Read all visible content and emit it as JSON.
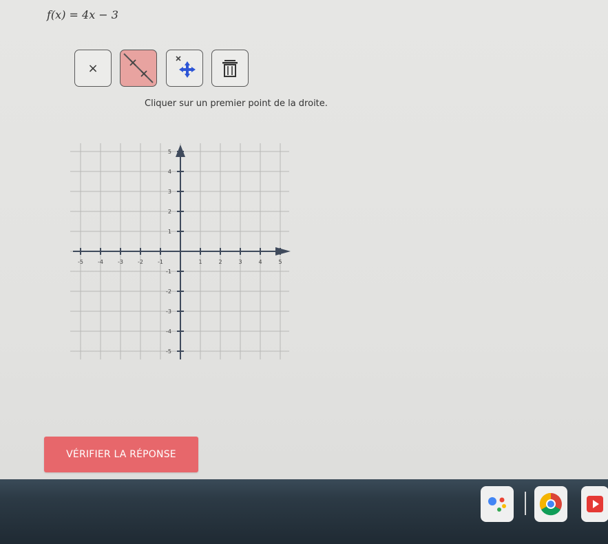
{
  "equation": "f(x) = 4x − 3",
  "toolbar": {
    "close_label": "×",
    "tools": [
      "close",
      "line",
      "move",
      "delete"
    ],
    "active_tool": "line"
  },
  "instruction": "Cliquer sur un premier point de la droite.",
  "graph": {
    "x_ticks": [
      "-5",
      "-4",
      "-3",
      "-2",
      "-1",
      "1",
      "2",
      "3",
      "4",
      "5"
    ],
    "y_ticks": [
      "5",
      "4",
      "3",
      "2",
      "1",
      "-1",
      "-2",
      "-3",
      "-4",
      "-5"
    ],
    "xlim": [
      -5,
      5
    ],
    "ylim": [
      -5,
      5
    ],
    "grid": true
  },
  "verify_button": "VÉRIFIER LA RÉPONSE",
  "shelf": {
    "icons": [
      "assistant-icon",
      "chrome-icon",
      "play-store-icon"
    ]
  },
  "colors": {
    "accent": "#e7676b",
    "axis": "#3f4a5c",
    "active_tool": "#e8a3a0",
    "move_icon": "#2d55d6"
  }
}
